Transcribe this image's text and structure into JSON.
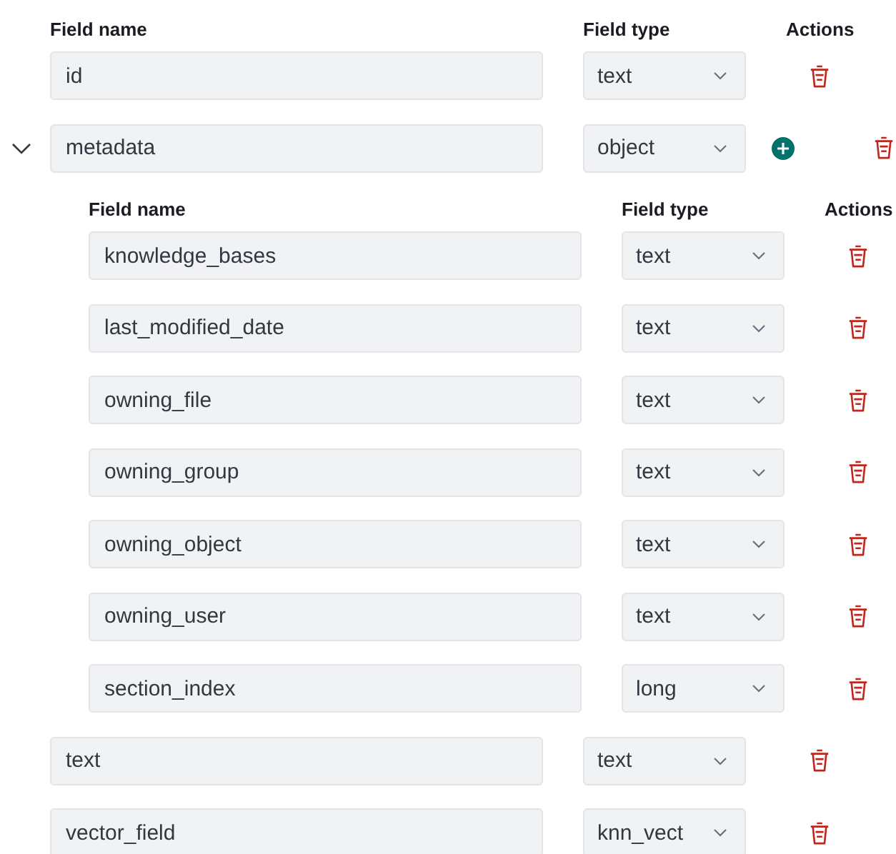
{
  "headers": {
    "name": "Field name",
    "type": "Field type",
    "actions": "Actions"
  },
  "fields": [
    {
      "name": "id",
      "type": "text"
    },
    {
      "name": "metadata",
      "type": "object",
      "expanded": true,
      "headers": {
        "name": "Field name",
        "type": "Field type",
        "actions": "Actions"
      },
      "children": [
        {
          "name": "knowledge_bases",
          "type": "text"
        },
        {
          "name": "last_modified_date",
          "type": "text"
        },
        {
          "name": "owning_file",
          "type": "text"
        },
        {
          "name": "owning_group",
          "type": "text"
        },
        {
          "name": "owning_object",
          "type": "text"
        },
        {
          "name": "owning_user",
          "type": "text"
        },
        {
          "name": "section_index",
          "type": "long"
        }
      ]
    },
    {
      "name": "text",
      "type": "text"
    },
    {
      "name": "vector_field",
      "type": "knn_vect"
    }
  ]
}
